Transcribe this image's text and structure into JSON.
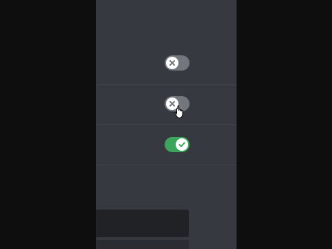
{
  "window": {
    "top_text": "…"
  },
  "toggles": [
    {
      "state": "off",
      "icon": "x-icon"
    },
    {
      "state": "off",
      "icon": "x-icon"
    },
    {
      "state": "on",
      "icon": "check-icon"
    }
  ],
  "colors": {
    "panel_bg": "#36393f",
    "toggle_off": "#72767d",
    "toggle_on": "#3ba55c",
    "input_bg": "#202225"
  }
}
